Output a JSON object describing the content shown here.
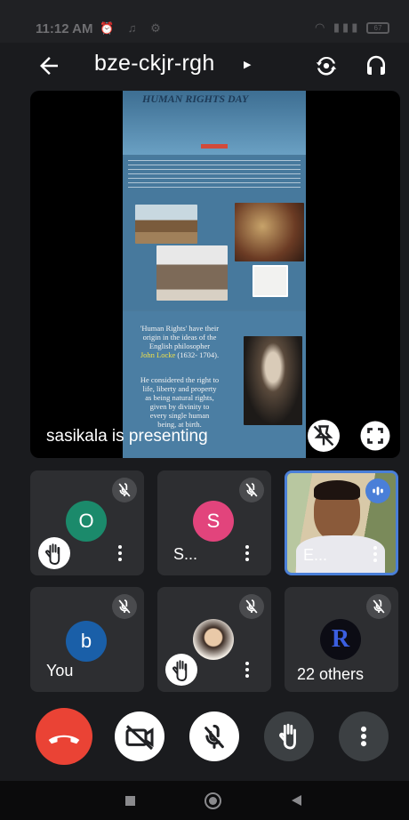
{
  "status_bar": {
    "time": "11:12 AM",
    "battery": "67"
  },
  "header": {
    "meeting_code": "bze-ckjr-rgh"
  },
  "presentation": {
    "slide_title": "HUMAN RIGHTS DAY",
    "slide_quote_lines": [
      "'Human Rights' have their",
      "origin in the ideas of the",
      "English philosopher"
    ],
    "slide_name": "John Locke",
    "slide_years": "(1632- 1704).",
    "slide_body_lines": [
      "He considered the right to",
      "life, liberty and property",
      "as being natural rights,",
      "given by divinity to",
      "every single human",
      "being, at birth."
    ],
    "presenter_caption": "sasikala is presenting"
  },
  "participants": [
    {
      "avatar_letter": "O",
      "name": "",
      "avatar_color": "#1b8a6b",
      "hand_raised": true
    },
    {
      "avatar_letter": "S",
      "name": "S...",
      "avatar_color": "#e2447c",
      "hand_raised": false
    },
    {
      "avatar_letter": "",
      "name": "E...",
      "video": true,
      "speaking": true
    },
    {
      "avatar_letter": "b",
      "name": "You",
      "avatar_color": "#1a5fa8",
      "hand_raised": false
    },
    {
      "avatar_letter": "",
      "name": "",
      "photo_avatar": true,
      "hand_raised": true
    },
    {
      "avatar_letter": "R",
      "name": "22 others"
    }
  ],
  "controls": {
    "items": [
      "end-call",
      "camera-off",
      "mic-off",
      "raise-hand",
      "more-options"
    ],
    "end_call_color": "#ea4335"
  },
  "colors": {
    "background": "#1a1b1e",
    "tile": "#2d2e31",
    "active_speaker_border": "#4a7fd8"
  }
}
